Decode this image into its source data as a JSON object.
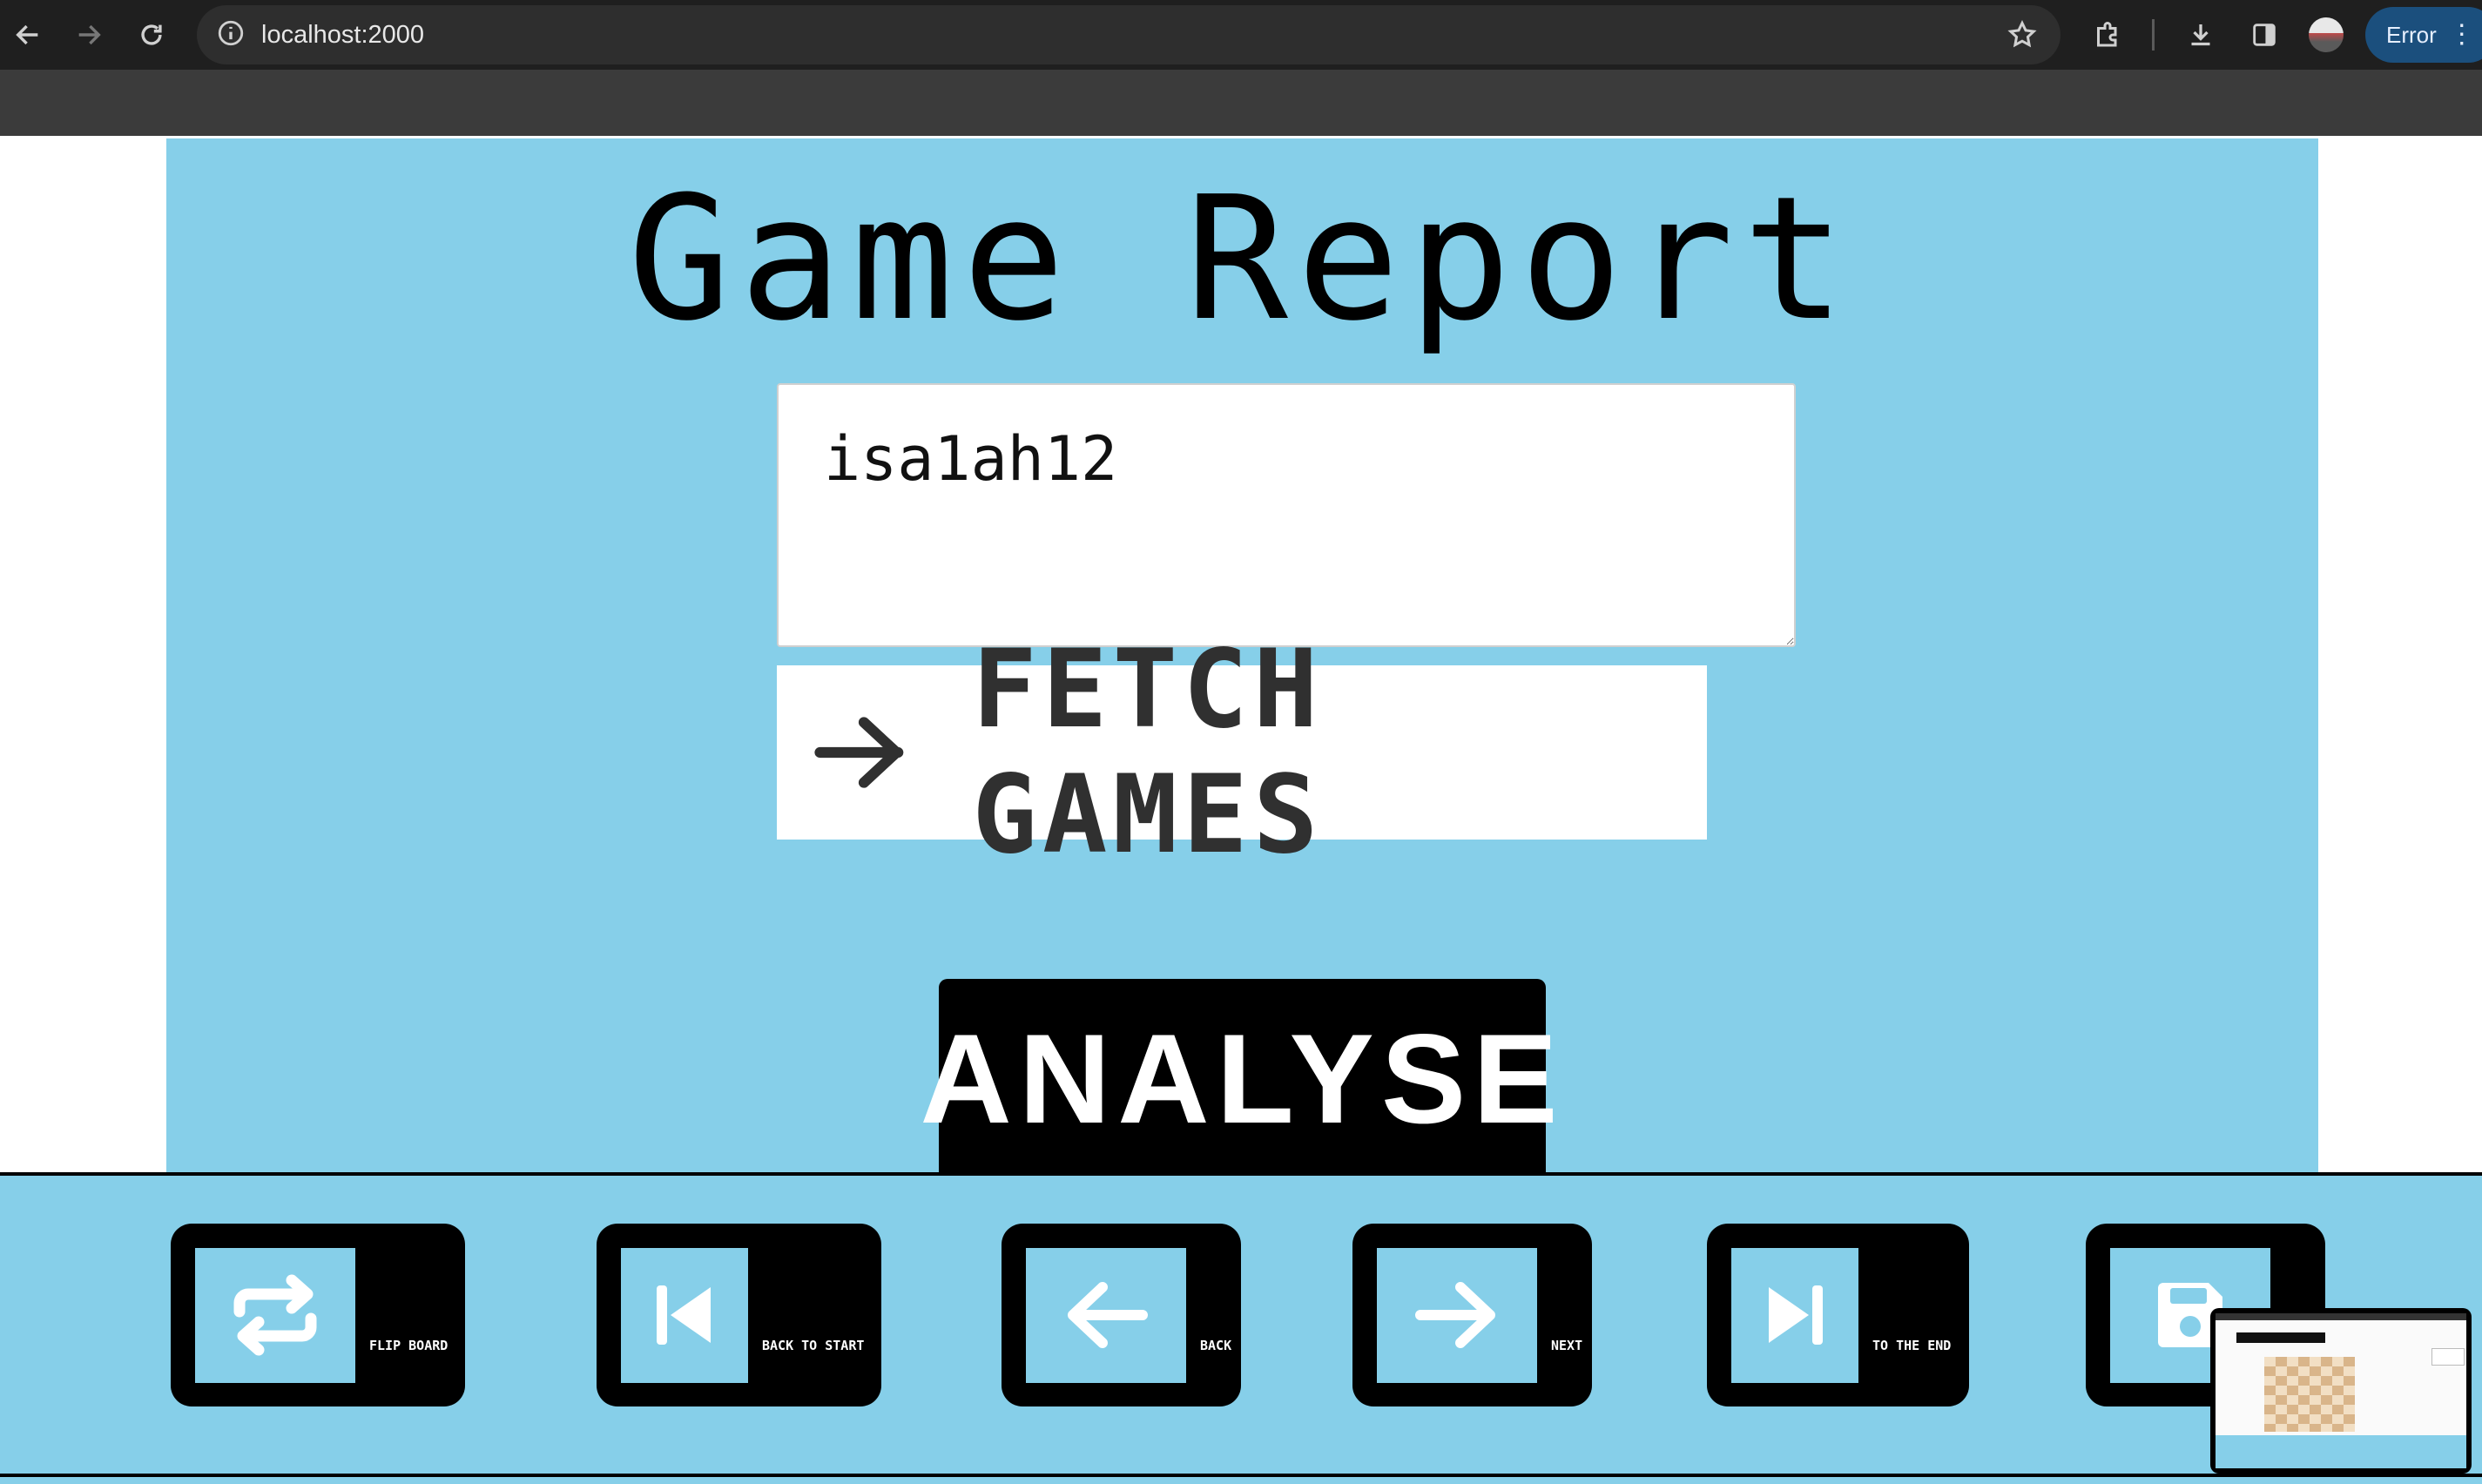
{
  "browser": {
    "url": "localhost:2000",
    "error_label": "Error"
  },
  "page": {
    "title": "Game Report",
    "username_value": "isa1ah12",
    "fetch_label": "FETCH GAMES",
    "analyse_label": "ANALYSE"
  },
  "toolbar": {
    "buttons": [
      {
        "label": "FLIP BOARD",
        "icon": "swap-arrows-icon"
      },
      {
        "label": "BACK TO START",
        "icon": "skip-back-icon"
      },
      {
        "label": "BACK",
        "icon": "arrow-left-icon"
      },
      {
        "label": "NEXT",
        "icon": "arrow-right-icon"
      },
      {
        "label": "TO THE END",
        "icon": "skip-forward-icon"
      },
      {
        "label": "",
        "icon": "save-icon"
      }
    ]
  },
  "colors": {
    "page_background": "#86cfe9",
    "button_dark": "#000000",
    "button_light": "#ffffff"
  }
}
